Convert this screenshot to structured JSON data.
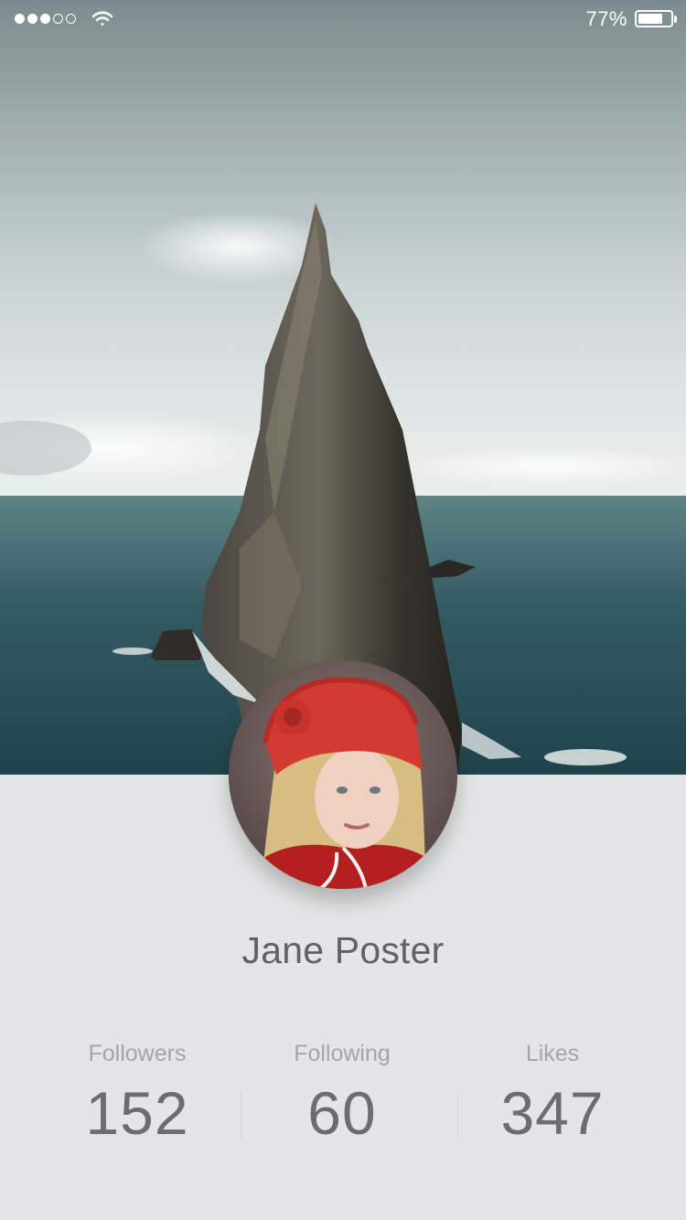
{
  "status_bar": {
    "signal_dots_total": 5,
    "signal_dots_filled": 3,
    "wifi_icon": "wifi-icon",
    "battery_percent_label": "77%",
    "battery_level": 0.77
  },
  "cover": {
    "image": "sea-stack-photo"
  },
  "profile": {
    "avatar": "avatar-photo",
    "name": "Jane Poster"
  },
  "stats": [
    {
      "label": "Followers",
      "value": "152"
    },
    {
      "label": "Following",
      "value": "60"
    },
    {
      "label": "Likes",
      "value": "347"
    }
  ],
  "colors": {
    "background": "#e3e6e6",
    "name_text": "#5f6364",
    "stat_label": "#a2a6a7",
    "stat_value": "#6a6e6f"
  }
}
